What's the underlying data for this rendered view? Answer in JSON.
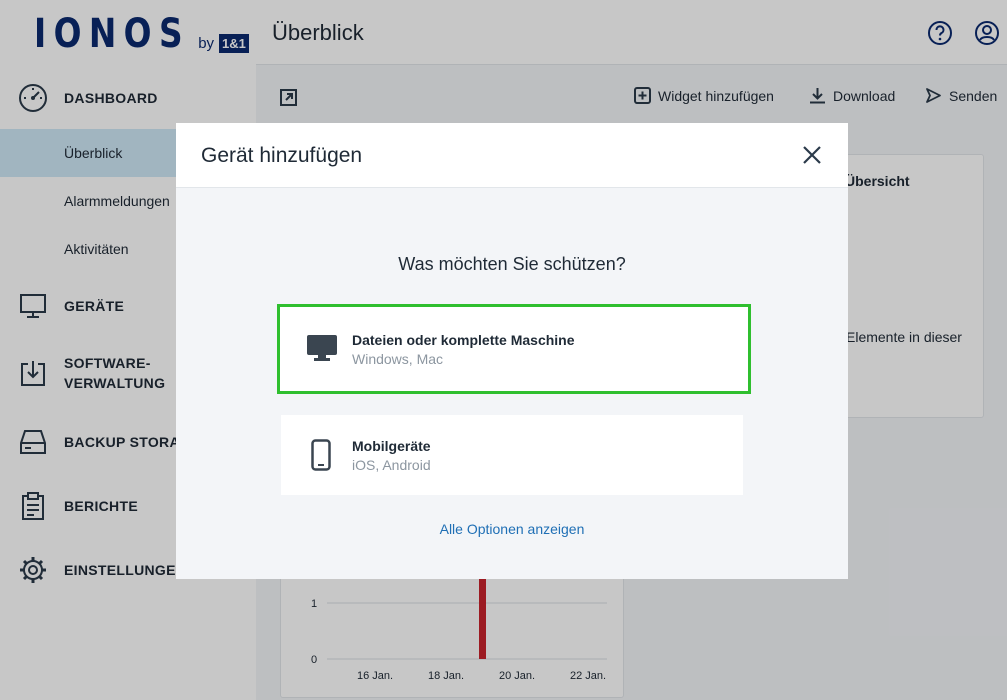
{
  "brand": {
    "name": "IONOS",
    "by": "by",
    "partner": "1&1"
  },
  "header": {
    "title": "Überblick"
  },
  "sidebar": {
    "dashboard": "DASHBOARD",
    "sub_items": [
      "Überblick",
      "Alarmmeldungen",
      "Aktivitäten"
    ],
    "geraete": "GERÄTE",
    "software_line1": "SOFTWARE-",
    "software_line2": "VERWALTUNG",
    "backup": "BACKUP STORAGE",
    "berichte": "BERICHTE",
    "einstellungen": "EINSTELLUNGEN"
  },
  "toolbar": {
    "widget_add": "Widget hinzufügen",
    "download": "Download",
    "send": "Senden"
  },
  "background_widgets": {
    "right_title": "Übersicht",
    "right_text": "Elemente in dieser"
  },
  "chart_data": {
    "type": "bar",
    "x_tick_labels": [
      "16 Jan.",
      "18 Jan.",
      "20 Jan.",
      "22 Jan."
    ],
    "y_tick_labels": [
      "1",
      "0"
    ],
    "bar_color": "#c8232c"
  },
  "modal": {
    "title": "Gerät hinzufügen",
    "question": "Was möchten Sie schützen?",
    "options": [
      {
        "title": "Dateien oder komplette Maschine",
        "subtitle": "Windows, Mac",
        "icon": "monitor-icon",
        "selected": true
      },
      {
        "title": "Mobilgeräte",
        "subtitle": "iOS, Android",
        "icon": "smartphone-icon",
        "selected": false
      }
    ],
    "all_options_link": "Alle Optionen anzeigen"
  },
  "colors": {
    "brand": "#0b2a6f",
    "selection": "#2fbf2f",
    "link": "#1f6fb5",
    "active_nav": "#cfe8f7"
  }
}
